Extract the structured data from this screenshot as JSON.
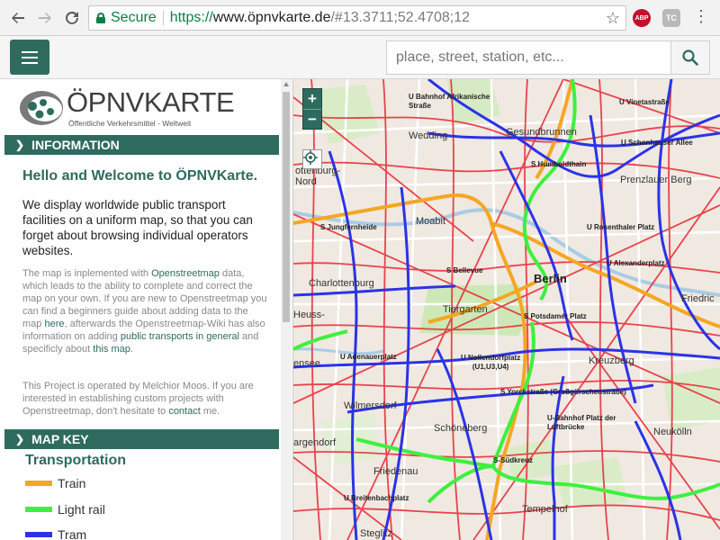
{
  "browser": {
    "secure_label": "Secure",
    "url_scheme": "https://",
    "url_host": "www.öpnvkarte.de",
    "url_rest": "/#13.3711;52.4708;12",
    "extensions": [
      "ABP",
      "TC"
    ]
  },
  "header": {
    "search_placeholder": "place, street, station, etc..."
  },
  "sidebar": {
    "logo_title": "ÖPNVKARTE",
    "logo_subtitle": "Öffentliche Verkehrsmittel - Weltweit",
    "information_heading": "INFORMATION",
    "welcome": "Hello and Welcome to ÖPNVKarte.",
    "lead": "We display worldwide public transport facilities on a uniform map, so that you can forget about browsing individual operators websites.",
    "p1_a": "The map is inplemented with ",
    "p1_link1": "Openstreetmap",
    "p1_b": " data, which leads to the ability to complete and correct the map on your own. If you are new to Openstreetmap you can find a beginners guide about adding data to the map ",
    "p1_link2": "here",
    "p1_c": ", afterwards the Openstreetmap-Wiki has also information on adding ",
    "p1_link3": "public transports in general",
    "p1_d": " and specificly about ",
    "p1_link4": "this map",
    "p1_e": ".",
    "p2_a": "This Project is operated by Melchior Moos. If you are interested in establishing custom projects with Openstreetmap, don't hesitate to ",
    "p2_link": "contact",
    "p2_b": " me.",
    "mapkey_heading": "MAP KEY",
    "transport_heading": "Transportation",
    "key": [
      {
        "label": "Train",
        "color": "#f5a623"
      },
      {
        "label": "Light rail",
        "color": "#3ef03e"
      },
      {
        "label": "Tram",
        "color": "#2b33e6"
      }
    ]
  },
  "map": {
    "labels": {
      "berlin": "Berlin",
      "wedding": "Wedding",
      "gesundbrunnen": "Gesundbrunnen",
      "moabit": "Moabit",
      "charlottenburg": "Charlottenburg",
      "tiergarten": "Tiergarten",
      "kreuzberg": "Kreuzberg",
      "wilmersdorf": "Wilmersdorf",
      "schoeneberg": "Schöneberg",
      "friedenau": "Friedenau",
      "tempelhof": "Tempelhof",
      "neukoelln": "Neukölln",
      "steglitz": "Steglitz",
      "prenzlauer_berg": "Prenzlauer Berg",
      "friedrichshain": "Friedric",
      "charlottenburg_nord": "ottenburg-\nNord",
      "heuss": "Heuss-",
      "ensee": "ensee",
      "argendorf": "argendorf"
    },
    "stations": {
      "afrikanische": "U Bahnhof Afrikanische\nStraße",
      "vinetastrasse": "U Vinetastraße",
      "schoenhauser": "U Schonhauser Allee",
      "humboldthain": "S Humboldthain",
      "jungfernheide": "S Jungfernheide",
      "rosenthaler": "U Rosenthaler Platz",
      "bellevue": "S Bellevue",
      "alexanderplatz": "U Alexanderplatz",
      "potsdamer": "S Potsdamer Platz",
      "adenauer": "U Adenauerplatz",
      "nollendorf": "U Nollendorfplatz\n(U1,U3,U4)",
      "yorck": "S Yorckstraße (Großgörschenstraße)",
      "luftbruecke": "U-Bahnhof Platz der\nLuftbrücke",
      "suedkreuz": "S-Südkreuz",
      "breitenbach": "U Breitenbachplatz"
    },
    "controls": {
      "zoom_in": "+",
      "zoom_out": "−"
    }
  }
}
